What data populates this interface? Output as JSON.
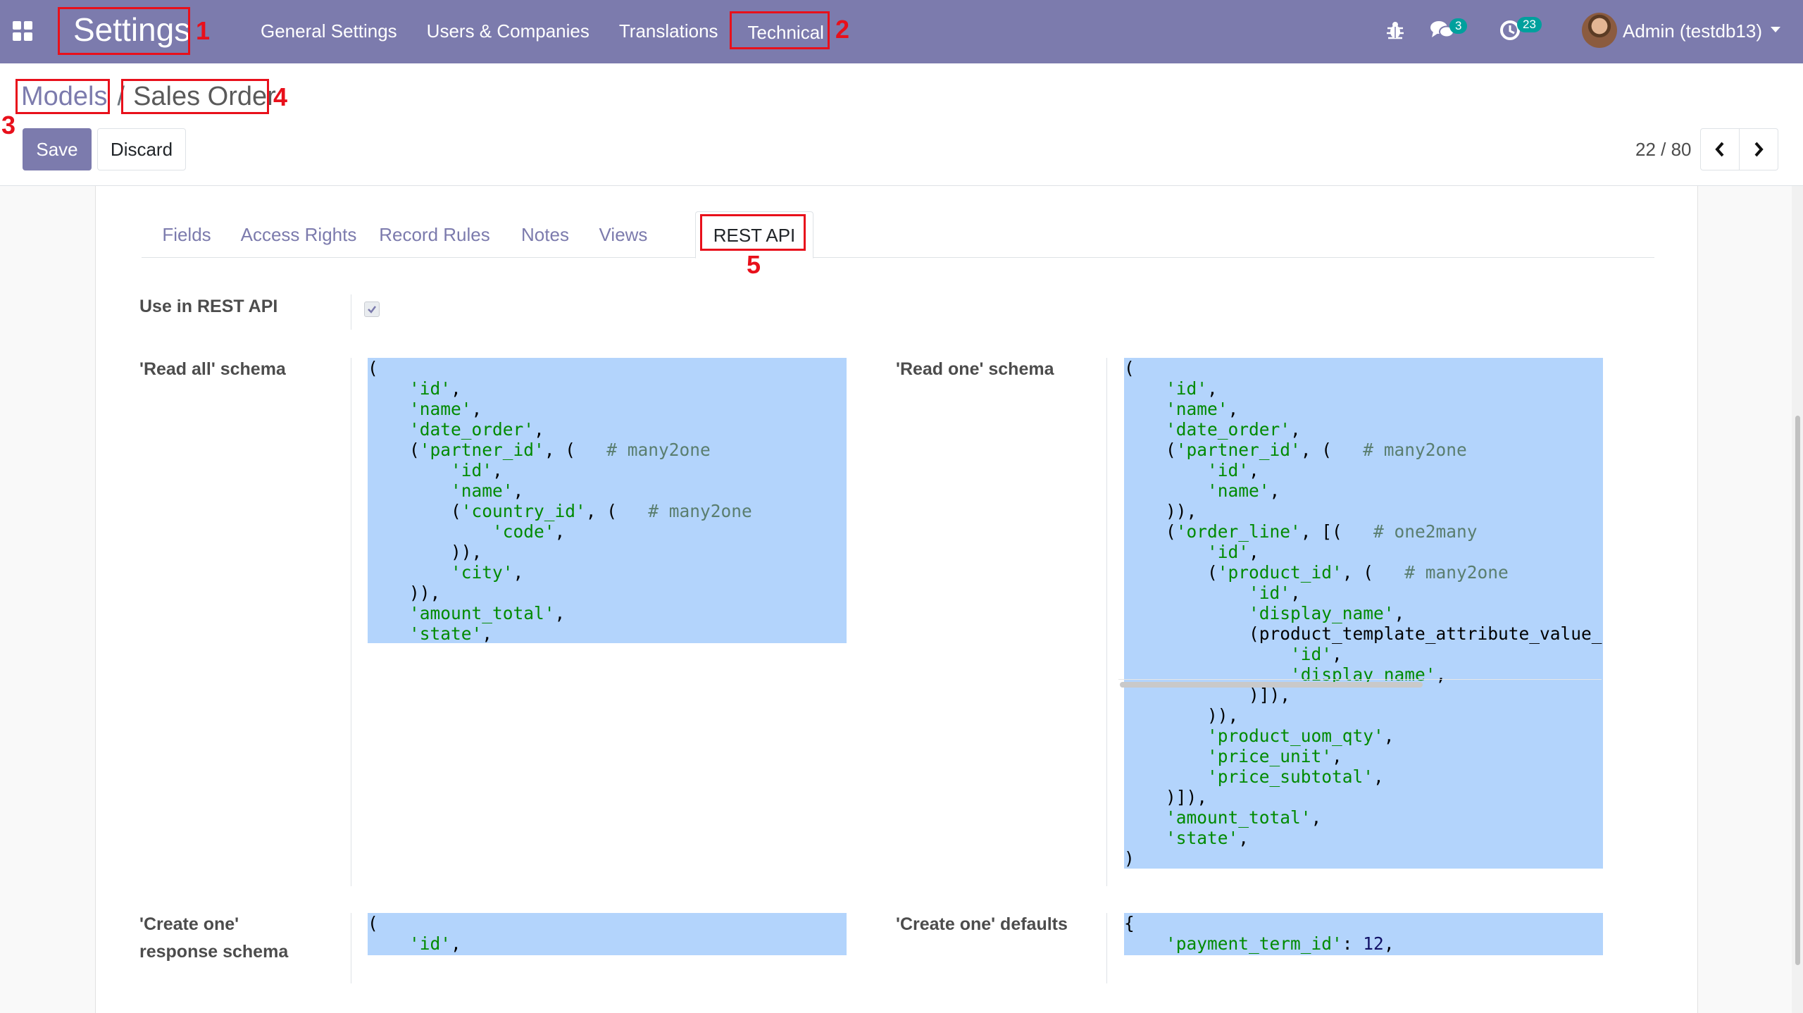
{
  "navbar": {
    "app_name": "Settings",
    "menu": [
      "General Settings",
      "Users & Companies",
      "Translations",
      "Technical"
    ],
    "chat_count": "3",
    "activity_count": "23",
    "user": "Admin (testdb13)"
  },
  "breadcrumb": {
    "parent": "Models",
    "separator": "/",
    "current": "Sales Order"
  },
  "buttons": {
    "save": "Save",
    "discard": "Discard"
  },
  "pager": {
    "value": "22 / 80"
  },
  "tabs": [
    "Fields",
    "Access Rights",
    "Record Rules",
    "Notes",
    "Views",
    "REST API"
  ],
  "active_tab": "REST API",
  "form": {
    "use_rest_api_label": "Use in REST API",
    "use_rest_api_checked": true,
    "read_all_label": "'Read all' schema",
    "read_one_label": "'Read one' schema",
    "create_one_label_1": "'Create one'",
    "create_one_label_2": "response schema",
    "create_defaults_label": "'Create one' defaults"
  },
  "code": {
    "read_all": [
      "(",
      "    'id',",
      "    'name',",
      "    'date_order',",
      "    ('partner_id', (   # many2one",
      "        'id',",
      "        'name',",
      "        ('country_id', (   # many2one",
      "            'code',",
      "        )),",
      "        'city',",
      "    )),",
      "    'amount_total',",
      "    'state',",
      ")"
    ],
    "read_one": [
      "(",
      "    'id',",
      "    'name',",
      "    'date_order',",
      "    ('partner_id', (   # many2one",
      "        'id',",
      "        'name',",
      "    )),",
      "    ('order_line', [(   # one2many",
      "        'id',",
      "        ('product_id', (   # many2one",
      "            'id',",
      "            'display_name',",
      "            ('product_template_attribute_value_",
      "                'id',",
      "                'display_name',",
      "            )]),",
      "        )),",
      "        'product_uom_qty',",
      "        'price_unit',",
      "        'price_subtotal',",
      "    )]),",
      "    'amount_total',",
      "    'state',",
      ")"
    ],
    "create_one": [
      "(",
      "    'id',",
      ")"
    ],
    "create_defaults": [
      "{",
      "    'payment_term_id': 12,",
      "}"
    ]
  },
  "annotations": [
    "1",
    "2",
    "3",
    "4",
    "5"
  ],
  "colors": {
    "primary": "#7c7bad",
    "annotation": "#e8101b",
    "selection": "#b3d4fc",
    "badge": "#00a09d"
  }
}
